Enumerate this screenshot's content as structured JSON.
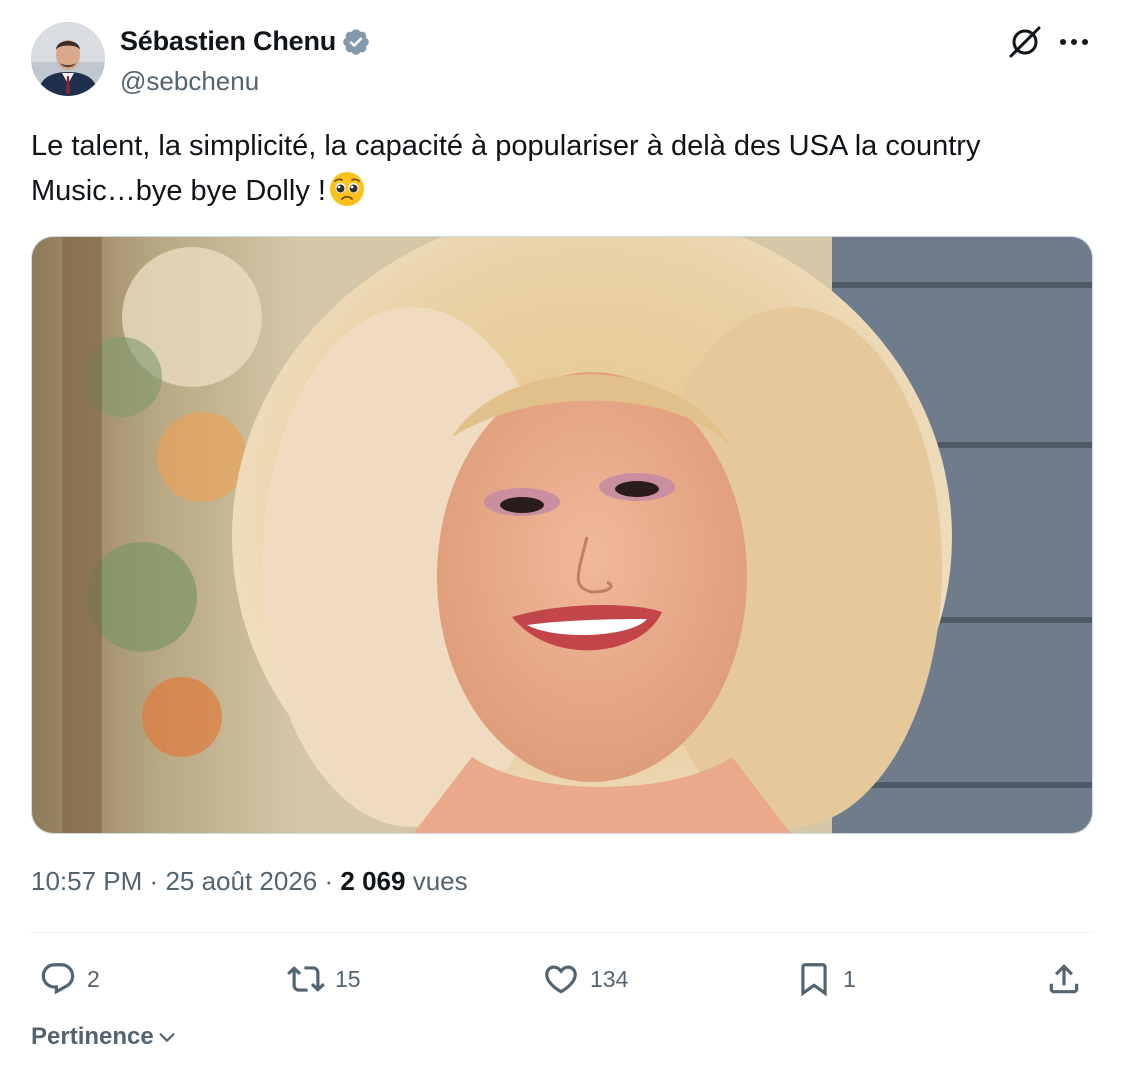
{
  "tweet": {
    "author": {
      "display_name": "Sébastien Chenu",
      "handle": "@sebchenu",
      "verified": true,
      "avatar_icon": "profile-photo"
    },
    "text": "Le talent, la simplicité, la capacité à populariser à delà des USA la country Music…bye bye Dolly !",
    "emoji": "pleading-face",
    "media": {
      "type": "photo",
      "icon": "portrait-photo"
    },
    "time": "10:57 PM",
    "separator": "·",
    "date": "25 août 2026",
    "views_count": "2 069",
    "views_label": "vues"
  },
  "actions": {
    "replies": {
      "icon": "reply-icon",
      "count": "2"
    },
    "reposts": {
      "icon": "repost-icon",
      "count": "15"
    },
    "likes": {
      "icon": "heart-icon",
      "count": "134"
    },
    "bookmarks": {
      "icon": "bookmark-icon",
      "count": "1"
    },
    "share": {
      "icon": "share-icon"
    }
  },
  "sort": {
    "label": "Pertinence",
    "icon": "chevron-down-icon"
  },
  "colors": {
    "text_primary": "#0f1419",
    "text_secondary": "#536471",
    "verified_badge": "#829aab",
    "divider": "#eff3f4"
  }
}
